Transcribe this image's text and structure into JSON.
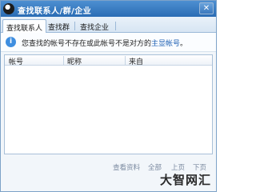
{
  "window": {
    "title": "查找联系人/群/企业",
    "close_glyph": "✕"
  },
  "tabs": [
    {
      "label": "查找联系人",
      "active": true
    },
    {
      "label": "查找群",
      "active": false
    },
    {
      "label": "查找企业",
      "active": false
    }
  ],
  "info": {
    "icon_glyph": "i",
    "text": "您查找的帐号不存在或此帐号不是对方的",
    "link": "主显帐号",
    "suffix": "。"
  },
  "table": {
    "columns": [
      "帐号",
      "昵称",
      "来自"
    ]
  },
  "pager": {
    "view_profile": "查看资料",
    "all": "全部",
    "prev": "上页",
    "next": "下页"
  },
  "watermark": "大智网汇",
  "colors": {
    "titlebar": "#2a6cb4",
    "link": "#1c5fb3",
    "disabled_text": "#7b8aa0"
  }
}
